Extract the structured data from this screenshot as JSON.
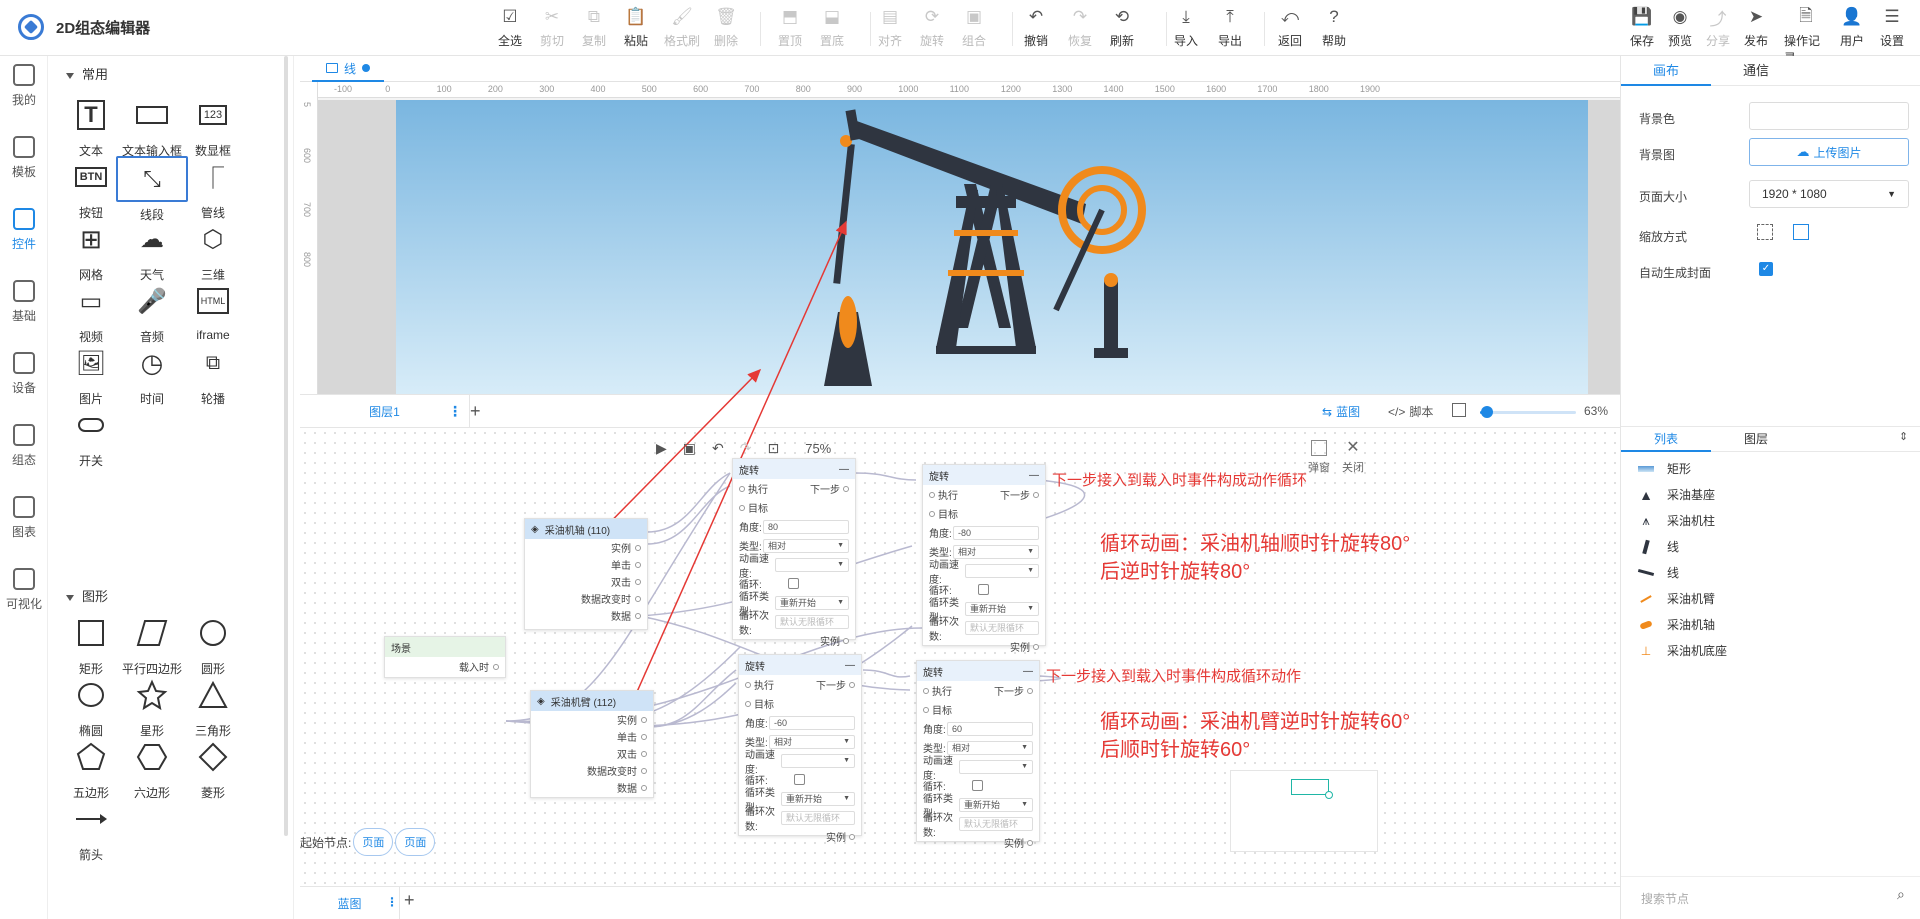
{
  "app": {
    "title": "2D组态编辑器"
  },
  "toolbar": {
    "groups": [
      {
        "label": "全选",
        "icon": "select-all-icon",
        "enabled": true
      },
      {
        "label": "剪切",
        "icon": "cut-icon",
        "enabled": false
      },
      {
        "label": "复制",
        "icon": "copy-icon",
        "enabled": false
      },
      {
        "label": "粘贴",
        "icon": "paste-icon",
        "enabled": true
      },
      {
        "label": "格式刷",
        "icon": "format-brush-icon",
        "enabled": false
      },
      {
        "label": "删除",
        "icon": "delete-icon",
        "enabled": false
      },
      {
        "label": "置顶",
        "icon": "bring-top-icon",
        "enabled": false
      },
      {
        "label": "置底",
        "icon": "send-bottom-icon",
        "enabled": false
      },
      {
        "label": "对齐",
        "icon": "align-icon",
        "enabled": false
      },
      {
        "label": "旋转",
        "icon": "rotate-icon",
        "enabled": false
      },
      {
        "label": "组合",
        "icon": "group-icon",
        "enabled": false
      },
      {
        "label": "撤销",
        "icon": "undo-icon",
        "enabled": true
      },
      {
        "label": "恢复",
        "icon": "redo-icon",
        "enabled": false
      },
      {
        "label": "刷新",
        "icon": "refresh-icon",
        "enabled": true
      },
      {
        "label": "导入",
        "icon": "import-icon",
        "enabled": true
      },
      {
        "label": "导出",
        "icon": "export-icon",
        "enabled": true
      },
      {
        "label": "返回",
        "icon": "back-icon",
        "enabled": true
      },
      {
        "label": "帮助",
        "icon": "help-icon",
        "enabled": true
      }
    ],
    "right": [
      {
        "label": "保存",
        "icon": "save-icon",
        "enabled": true
      },
      {
        "label": "预览",
        "icon": "preview-icon",
        "enabled": true
      },
      {
        "label": "分享",
        "icon": "share-icon",
        "enabled": false
      },
      {
        "label": "发布",
        "icon": "publish-icon",
        "enabled": true
      },
      {
        "label": "操作记录",
        "icon": "history-icon",
        "enabled": true
      },
      {
        "label": "用户",
        "icon": "user-icon",
        "enabled": true
      },
      {
        "label": "设置",
        "icon": "settings-icon",
        "enabled": true
      }
    ]
  },
  "leftnav": [
    {
      "label": "我的",
      "active": false
    },
    {
      "label": "模板",
      "active": false
    },
    {
      "label": "控件",
      "active": true
    },
    {
      "label": "基础",
      "active": false
    },
    {
      "label": "设备",
      "active": false
    },
    {
      "label": "组态",
      "active": false
    },
    {
      "label": "图表",
      "active": false
    },
    {
      "label": "可视化",
      "active": false
    }
  ],
  "panel": {
    "section_common": "常用",
    "section_shapes": "图形",
    "common": [
      "文本",
      "文本输入框",
      "数显框",
      "按钮",
      "线段",
      "管线",
      "网格",
      "天气",
      "三维",
      "视频",
      "音频",
      "iframe",
      "图片",
      "时间",
      "轮播",
      "开关"
    ],
    "common_glyphs": {
      "num": "123",
      "btn": "BTN",
      "html": "HTML"
    },
    "shapes": [
      "矩形",
      "平行四边形",
      "圆形",
      "椭圆",
      "星形",
      "三角形",
      "五边形",
      "六边形",
      "菱形",
      "箭头"
    ]
  },
  "canvas": {
    "tab": "线",
    "ruler_h": [
      "-100",
      "0",
      "100",
      "200",
      "300",
      "400",
      "500",
      "600",
      "700",
      "800",
      "900",
      "1000",
      "1100",
      "1200",
      "1300",
      "1400",
      "1500",
      "1600",
      "1700",
      "1800",
      "1900"
    ],
    "ruler_v": [
      "5",
      "600",
      "700",
      "800"
    ],
    "layer": "图层1",
    "view_blueprint": "蓝图",
    "view_script": "脚本",
    "zoom": "63%",
    "zoom_fraction": 0.07
  },
  "blueprint": {
    "zoom": "75%",
    "popup": "弹窗",
    "close": "关闭",
    "start_label": "起始节点:",
    "start_pills": [
      "页面",
      "页面"
    ],
    "bottom_tab": "蓝图",
    "scene": {
      "title": "场景",
      "out": "载入时"
    },
    "obj1": {
      "title": "采油机轴 (110)",
      "pins": [
        "实例",
        "单击",
        "双击",
        "数据改变时",
        "数据"
      ]
    },
    "obj2": {
      "title": "采油机臂 (112)",
      "pins": [
        "实例",
        "单击",
        "双击",
        "数据改变时",
        "数据"
      ]
    },
    "rotate_nodes": [
      {
        "title": "旋转",
        "angle": "80",
        "type": "相对",
        "loop_type": "重新开始",
        "loop_count": "默认无限循环",
        "checked": false
      },
      {
        "title": "旋转",
        "angle": "-80",
        "type": "相对",
        "loop_type": "重新开始",
        "loop_count": "默认无限循环",
        "checked": false
      },
      {
        "title": "旋转",
        "angle": "-60",
        "type": "相对",
        "loop_type": "重新开始",
        "loop_count": "默认无限循环",
        "checked": false
      },
      {
        "title": "旋转",
        "angle": "60",
        "type": "相对",
        "loop_type": "重新开始",
        "loop_count": "默认无限循环",
        "checked": false
      }
    ],
    "labels": {
      "exec": "执行",
      "next": "下一步",
      "target": "目标",
      "angle": "角度:",
      "type": "类型:",
      "speed": "动画速度:",
      "loop": "循环:",
      "loop_type": "循环类型:",
      "loop_count": "循环次数:",
      "instance": "实例"
    },
    "notes": {
      "n1": "下一步接入到载入时事件构成动作循环",
      "n2a": "循环动画：采油机轴顺时针旋转80°",
      "n2b": "后逆时针旋转80°",
      "n3": "下一步接入到载入时事件构成循环动作",
      "n4a": "循环动画：采油机臂逆时针旋转60°",
      "n4b": "后顺时针旋转60°"
    }
  },
  "right": {
    "tabs": [
      "画布",
      "通信"
    ],
    "bg_color": "背景色",
    "bg_image": "背景图",
    "upload": "上传图片",
    "page_size": "页面大小",
    "page_size_value": "1920 * 1080",
    "scale_mode": "缩放方式",
    "auto_cover": "自动生成封面",
    "list_tabs": [
      "列表",
      "图层"
    ],
    "list": [
      "矩形",
      "采油基座",
      "采油机柱",
      "线",
      "线",
      "采油机臂",
      "采油机轴",
      "采油机底座"
    ],
    "search_placeholder": "搜索节点"
  },
  "colors": {
    "accent": "#1e88e5",
    "note": "#e53935",
    "pump": "#2f3540",
    "pump_orange": "#f08a1c"
  }
}
